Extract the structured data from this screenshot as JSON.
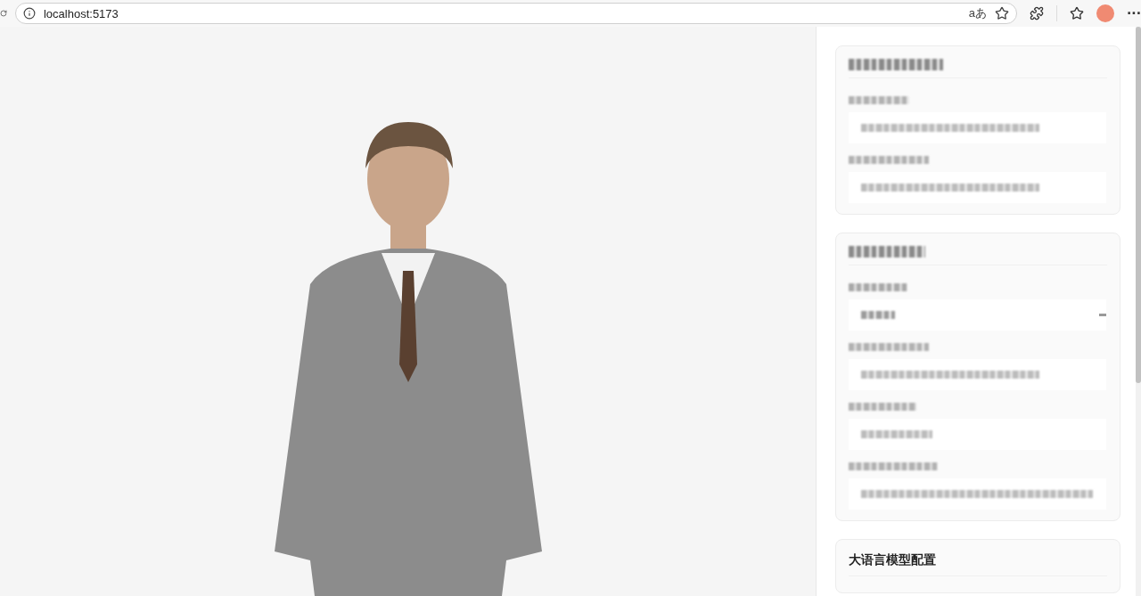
{
  "browser": {
    "url": "localhost:5173",
    "translate_glyph": "aあ",
    "more_glyph": "···"
  },
  "settings_panels": [
    {
      "fields": [
        {
          "kind": "input"
        },
        {
          "kind": "input"
        }
      ]
    },
    {
      "fields": [
        {
          "kind": "select"
        },
        {
          "kind": "input"
        },
        {
          "kind": "input"
        },
        {
          "kind": "input"
        }
      ]
    },
    {
      "title": "大语言模型配置"
    }
  ]
}
